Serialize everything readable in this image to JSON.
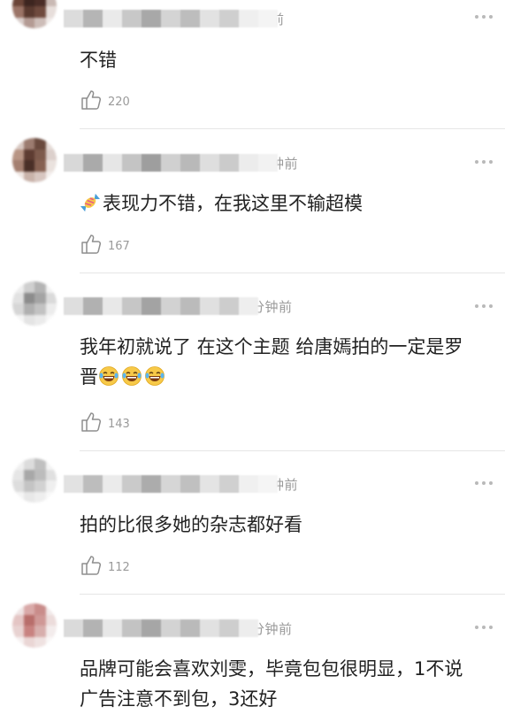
{
  "comments": [
    {
      "time": "前",
      "text": "不错",
      "likes": "220",
      "prefix_emoji": "",
      "suffix_emoji_count": 0
    },
    {
      "time": "钟前",
      "text": "表现力不错，在我这里不输超模",
      "likes": "167",
      "prefix_emoji": "candy-emoji",
      "suffix_emoji_count": 0
    },
    {
      "time": "分钟前",
      "text": "我年初就说了 在这个主题 给唐嫣拍的一定是罗晋",
      "likes": "143",
      "prefix_emoji": "",
      "suffix_emoji": "laugh-cry-emoji",
      "suffix_emoji_count": 3
    },
    {
      "time": "钟前",
      "text": "拍的比很多她的杂志都好看",
      "likes": "112",
      "prefix_emoji": "",
      "suffix_emoji_count": 0
    },
    {
      "time": "分钟前",
      "text": "品牌可能会喜欢刘雯，毕竟包包很明显，1不说广告注意不到包，3还好",
      "likes": "",
      "prefix_emoji": "",
      "suffix_emoji_count": 0
    }
  ],
  "icons": {
    "like": "thumbs-up-icon",
    "more": "more-dots-icon"
  },
  "colors": {
    "text": "#222222",
    "muted": "#9a9a9a",
    "divider": "#e6e6e6"
  }
}
